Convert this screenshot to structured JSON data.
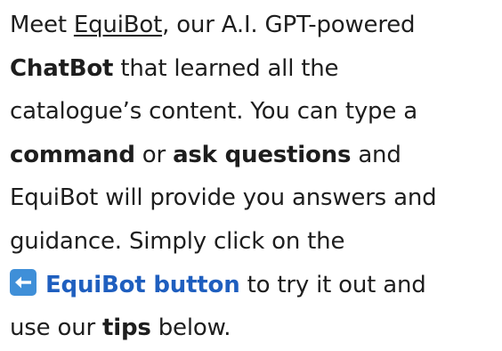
{
  "intro": {
    "l1_a": "Meet ",
    "l1_brand": "EquiBot",
    "l1_b": ", our A.I. GPT-powered",
    "l2_bold": "ChatBot",
    "l2_b": " that learned all the",
    "l3": "catalogue’s content. You can type a",
    "l4_bold1": "command",
    "l4_mid": " or ",
    "l4_bold2": "ask questions",
    "l4_end": " and",
    "l5": "EquiBot will provide you answers and",
    "l6": "guidance. Simply click on the",
    "l7_link": "EquiBot button",
    "l7_end": " to try it out and",
    "l8_a": "use our ",
    "l8_bold": "tips",
    "l8_end": " below."
  },
  "icons": {
    "left_arrow": "left-arrow-icon"
  },
  "colors": {
    "text": "#1e1e1e",
    "link": "#1f5fbf",
    "icon_bg": "#3f8fd8"
  }
}
